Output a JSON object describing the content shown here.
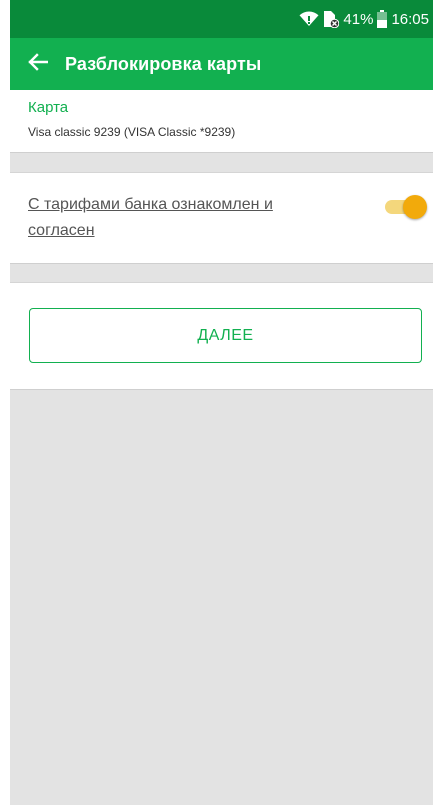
{
  "status_bar": {
    "battery": "41%",
    "time": "16:05",
    "icons": [
      "wifi-icon",
      "no-sim-icon",
      "battery-icon"
    ]
  },
  "app_bar": {
    "title": "Разблокировка карты",
    "back_icon": "arrow-left-icon"
  },
  "card": {
    "label": "Карта",
    "value": "Visa classic 9239 (VISA Classic *9239)"
  },
  "tariff": {
    "text": "С тарифами банка ознакомлен и согласен",
    "toggle_on": true
  },
  "actions": {
    "next_label": "ДАЛЕЕ"
  },
  "colors": {
    "status_bar": "#098a3a",
    "app_bar": "#12b050",
    "accent": "#12b050",
    "toggle_thumb": "#f2aa0b",
    "toggle_track": "#f4d77c",
    "background": "#e3e3e3"
  }
}
